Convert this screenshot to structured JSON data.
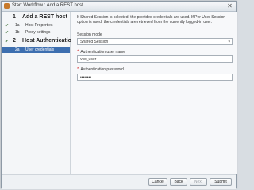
{
  "window": {
    "title": "Start Workflow : Add a REST host",
    "close_glyph": "✕"
  },
  "steps": [
    {
      "num": "1",
      "title": "Add a REST host",
      "substeps": [
        {
          "num": "1a",
          "title": "Host Properties",
          "done": true
        },
        {
          "num": "1b",
          "title": "Proxy settings",
          "done": true
        }
      ]
    },
    {
      "num": "2",
      "title": "Host Authentication",
      "substeps": [
        {
          "num": "2a",
          "title": "User credentials",
          "selected": true
        }
      ]
    }
  ],
  "form": {
    "info": "If Shared Session is selected, the provided credentials are used. If Per User Session option is used, the credentials are retrieved from the currently logged-in user.",
    "session_mode_label": "Session mode",
    "session_mode_value": "Shared Session",
    "required_marker": "*",
    "username_label": "Authentication user name",
    "username_value": "vco_user",
    "password_label": "Authentication password",
    "password_value": "••••••••"
  },
  "buttons": {
    "cancel": "Cancel",
    "back": "Back",
    "next": "Next",
    "submit": "Submit"
  },
  "colors": {
    "selected_bg": "#3d6fb0",
    "required": "#d62020",
    "check": "#3a6f35"
  },
  "icons": {
    "check": "✔",
    "dropdown": "▾"
  }
}
